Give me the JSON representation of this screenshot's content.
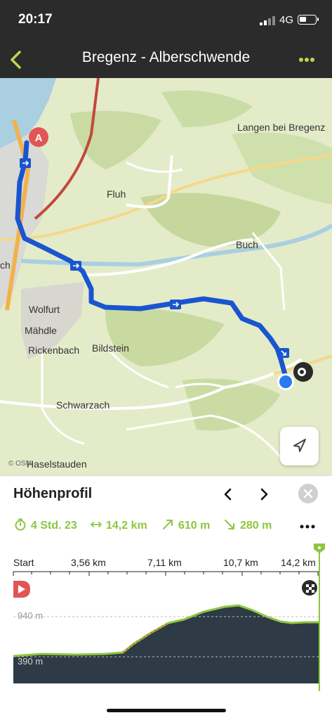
{
  "status_bar": {
    "time": "20:17",
    "network": "4G"
  },
  "nav": {
    "title": "Bregenz - Alberschwende",
    "back_icon": "chevron-left-icon",
    "more_icon": "ellipsis-icon",
    "accent": "#b8d94a"
  },
  "map": {
    "labels": {
      "langen": "Langen bei Bregenz",
      "fluh": "Fluh",
      "buch": "Buch",
      "ch": "ch",
      "wolfurt": "Wolfurt",
      "mahdle": "Mähdle",
      "rickenbach": "Rickenbach",
      "bildstein": "Bildstein",
      "schwarzach": "Schwarzach",
      "haselstauden": "Haselstauden"
    },
    "start_marker": "A",
    "attribution": "© OSM",
    "route_color": "#1a55d0"
  },
  "panel": {
    "title": "Höhenprofil",
    "stats": {
      "duration": "4 Std. 23",
      "distance": "14,2 km",
      "ascent": "610 m",
      "descent": "280 m"
    },
    "stat_color": "#8ec63f"
  },
  "profile": {
    "distance_labels": [
      "Start",
      "3,56 km",
      "7,11 km",
      "10,7 km",
      "14,2 km"
    ],
    "elev_top": "940 m",
    "elev_bottom": "390 m"
  }
}
